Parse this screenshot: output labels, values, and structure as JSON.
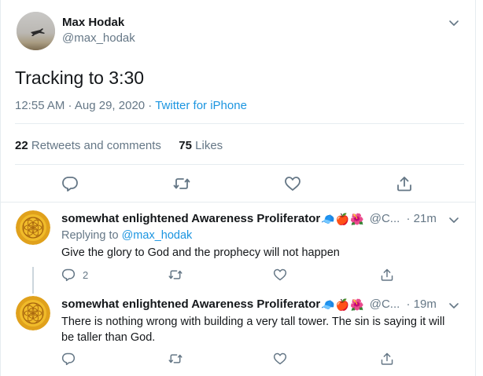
{
  "main_tweet": {
    "display_name": "Max Hodak",
    "handle": "@max_hodak",
    "text": "Tracking to 3:30",
    "time": "12:55 AM · Aug 29, 2020 ·",
    "source": "Twitter for iPhone",
    "retweets_count": "22",
    "retweets_label": "Retweets and comments",
    "likes_count": "75",
    "likes_label": "Likes"
  },
  "replies": [
    {
      "display_name": "somewhat enlightened Awareness Proliferator",
      "emojis": [
        "🧢",
        "🍎",
        "🌺"
      ],
      "handle": "@C...",
      "time": "· 21m",
      "replying_prefix": "Replying to",
      "replying_to": "@max_hodak",
      "text": "Give the glory to God and the prophecy will not happen",
      "reply_count": "2"
    },
    {
      "display_name": "somewhat enlightened Awareness Proliferator",
      "emojis": [
        "🧢",
        "🍎",
        "🌺"
      ],
      "handle": "@C...",
      "time": "· 19m",
      "text_line1": "There is nothing wrong with building a very tall tower. The sin is saying it will",
      "text_line2": "be taller than God."
    }
  ],
  "icons": {
    "reply": "reply-icon",
    "retweet": "retweet-icon",
    "like": "heart-icon",
    "share": "share-icon",
    "menu": "chevron-down-icon"
  },
  "colors": {
    "link": "#1b95e0",
    "muted": "#657786",
    "divider": "#e6ecf0",
    "text": "#14171a"
  }
}
